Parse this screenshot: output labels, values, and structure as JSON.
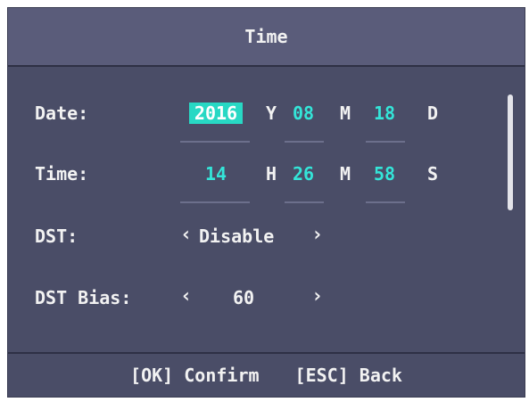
{
  "header": {
    "title": "Time"
  },
  "date": {
    "label": "Date:",
    "year": "2016",
    "year_unit": "Y",
    "month": "08",
    "month_unit": "M",
    "day": "18",
    "day_unit": "D"
  },
  "time": {
    "label": "Time:",
    "hour": "14",
    "hour_unit": "H",
    "minute": "26",
    "minute_unit": "M",
    "second": "58",
    "second_unit": "S"
  },
  "dst": {
    "label": "DST:",
    "value": "Disable",
    "left_arrow": "‹",
    "right_arrow": "›"
  },
  "dst_bias": {
    "label": "DST Bias:",
    "value": "60",
    "left_arrow": "‹",
    "right_arrow": "›"
  },
  "footer": {
    "confirm": "[OK] Confirm",
    "back": "[ESC] Back"
  },
  "colors": {
    "background": "#4a4d67",
    "titlebar": "#5a5c7a",
    "accent": "#34e5d8",
    "selected_bg": "#28d8c4",
    "text": "#f2f2f2"
  }
}
